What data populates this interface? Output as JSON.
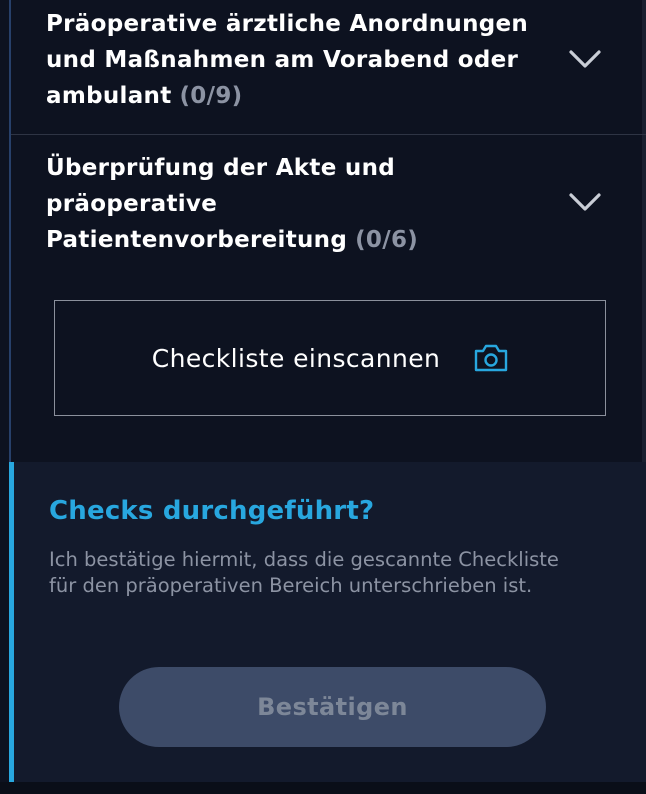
{
  "sections": [
    {
      "title": "Präoperative ärztliche Anordnungen und Maßnahmen am Vorabend oder ambulant",
      "count": "(0/9)",
      "icon": "chevron-down-icon"
    },
    {
      "title": "Überprüfung der Akte und präoperative Patientenvorbereitung",
      "count": "(0/6)",
      "icon": "chevron-down-icon"
    }
  ],
  "scan": {
    "label": "Checkliste einscannen",
    "icon": "camera-icon"
  },
  "confirm": {
    "heading": "Checks durchgeführt?",
    "text": "Ich bestätige hiermit, dass die gescannte Checkliste für den präoperativen Bereich unterschrieben ist.",
    "button_label": "Bestätigen"
  },
  "colors": {
    "background": "#0d1220",
    "panel": "#131a2c",
    "accent": "#28a7df",
    "muted_text": "#8c93a3",
    "button_disabled": "#3d4b68"
  }
}
